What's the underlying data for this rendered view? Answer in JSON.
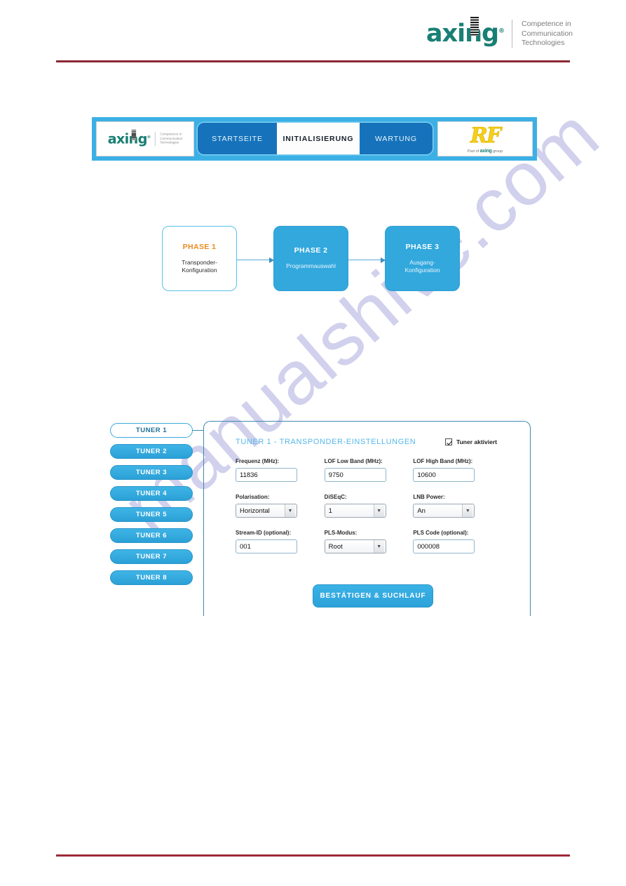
{
  "header": {
    "brand": "axing",
    "brand_registered": "®",
    "tagline_line1": "Competence in",
    "tagline_line2": "Communication",
    "tagline_line3": "Technologies",
    "rule_color": "#8c2733"
  },
  "watermark": {
    "text": "manualshive.com",
    "color": "#c9c9ea"
  },
  "navbar": {
    "background": "#3cb0e5",
    "logo": {
      "brand": "axing",
      "registered": "®",
      "tagline_line1": "Competence in",
      "tagline_line2": "Communication",
      "tagline_line3": "Technologies"
    },
    "tabs": [
      {
        "label": "STARTSEITE",
        "active": false
      },
      {
        "label": "INITIALISIERUNG",
        "active": true
      },
      {
        "label": "WARTUNG",
        "active": false
      }
    ],
    "rf_logo": {
      "mark": "RF",
      "sub_pre": "Part of ",
      "sub_brand": "axing",
      "sub_post": " group"
    }
  },
  "phases": [
    {
      "title": "PHASE 1",
      "subtitle_line1": "Transponder-",
      "subtitle_line2": "Konfiguration",
      "state": "current"
    },
    {
      "title": "PHASE 2",
      "subtitle_line1": "Programmauswahl",
      "subtitle_line2": "",
      "state": "next"
    },
    {
      "title": "PHASE 3",
      "subtitle_line1": "Ausgang-",
      "subtitle_line2": "Konfiguration",
      "state": "next"
    }
  ],
  "tuner_list": [
    {
      "label": "TUNER 1",
      "selected": true
    },
    {
      "label": "TUNER 2",
      "selected": false
    },
    {
      "label": "TUNER 3",
      "selected": false
    },
    {
      "label": "TUNER 4",
      "selected": false
    },
    {
      "label": "TUNER 5",
      "selected": false
    },
    {
      "label": "TUNER 6",
      "selected": false
    },
    {
      "label": "TUNER 7",
      "selected": false
    },
    {
      "label": "TUNER 8",
      "selected": false
    }
  ],
  "tuner_panel": {
    "title": "TUNER 1 - TRANSPONDER-EINSTELLUNGEN",
    "title_color": "#55b8e8",
    "enable_label": "Tuner aktiviert",
    "enable_checked": true,
    "fields": {
      "frequenz": {
        "label": "Frequenz (MHz):",
        "value": "11836",
        "type": "text"
      },
      "lof_low": {
        "label": "LOF Low Band (MHz):",
        "value": "9750",
        "type": "text"
      },
      "lof_high": {
        "label": "LOF High Band (MHz):",
        "value": "10600",
        "type": "text"
      },
      "polarisation": {
        "label": "Polarisation:",
        "value": "Horizontal",
        "type": "select"
      },
      "diseqc": {
        "label": "DiSEqC:",
        "value": "1",
        "type": "select"
      },
      "lnb_power": {
        "label": "LNB Power:",
        "value": "An",
        "type": "select"
      },
      "stream_id": {
        "label": "Stream-ID (optional):",
        "value": "001",
        "type": "text"
      },
      "pls_modus": {
        "label": "PLS-Modus:",
        "value": "Root",
        "type": "select"
      },
      "pls_code": {
        "label": "PLS Code (optional):",
        "value": "000008",
        "type": "text"
      }
    },
    "submit_label": "BESTÄTIGEN & SUCHLAUF"
  },
  "caret_glyph": "▼"
}
